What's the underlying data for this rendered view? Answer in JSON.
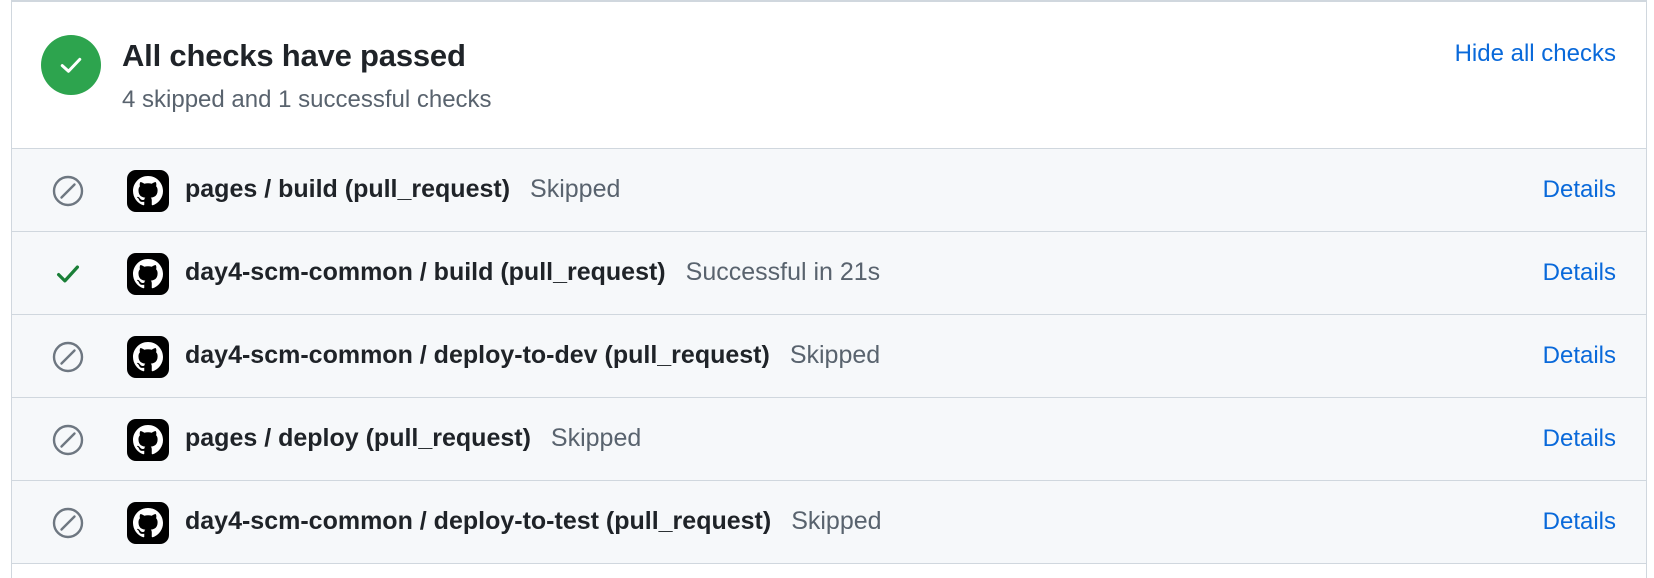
{
  "header": {
    "title": "All checks have passed",
    "subtitle": "4 skipped and 1 successful checks",
    "toggle_label": "Hide all checks",
    "status_icon": "check-circle-icon",
    "status_color": "#2da44e"
  },
  "checks": [
    {
      "name": "pages / build (pull_request)",
      "result": "Skipped",
      "status": "skipped",
      "status_icon": "skip-icon",
      "app_icon": "github-icon",
      "details_label": "Details"
    },
    {
      "name": "day4-scm-common / build (pull_request)",
      "result": "Successful in 21s",
      "status": "success",
      "status_icon": "check-icon",
      "app_icon": "github-icon",
      "details_label": "Details"
    },
    {
      "name": "day4-scm-common / deploy-to-dev (pull_request)",
      "result": "Skipped",
      "status": "skipped",
      "status_icon": "skip-icon",
      "app_icon": "github-icon",
      "details_label": "Details"
    },
    {
      "name": "pages / deploy (pull_request)",
      "result": "Skipped",
      "status": "skipped",
      "status_icon": "skip-icon",
      "app_icon": "github-icon",
      "details_label": "Details"
    },
    {
      "name": "day4-scm-common / deploy-to-test (pull_request)",
      "result": "Skipped",
      "status": "skipped",
      "status_icon": "skip-icon",
      "app_icon": "github-icon",
      "details_label": "Details"
    }
  ],
  "colors": {
    "link": "#0969da",
    "success": "#1a7f37",
    "skipped": "#6e7781"
  }
}
